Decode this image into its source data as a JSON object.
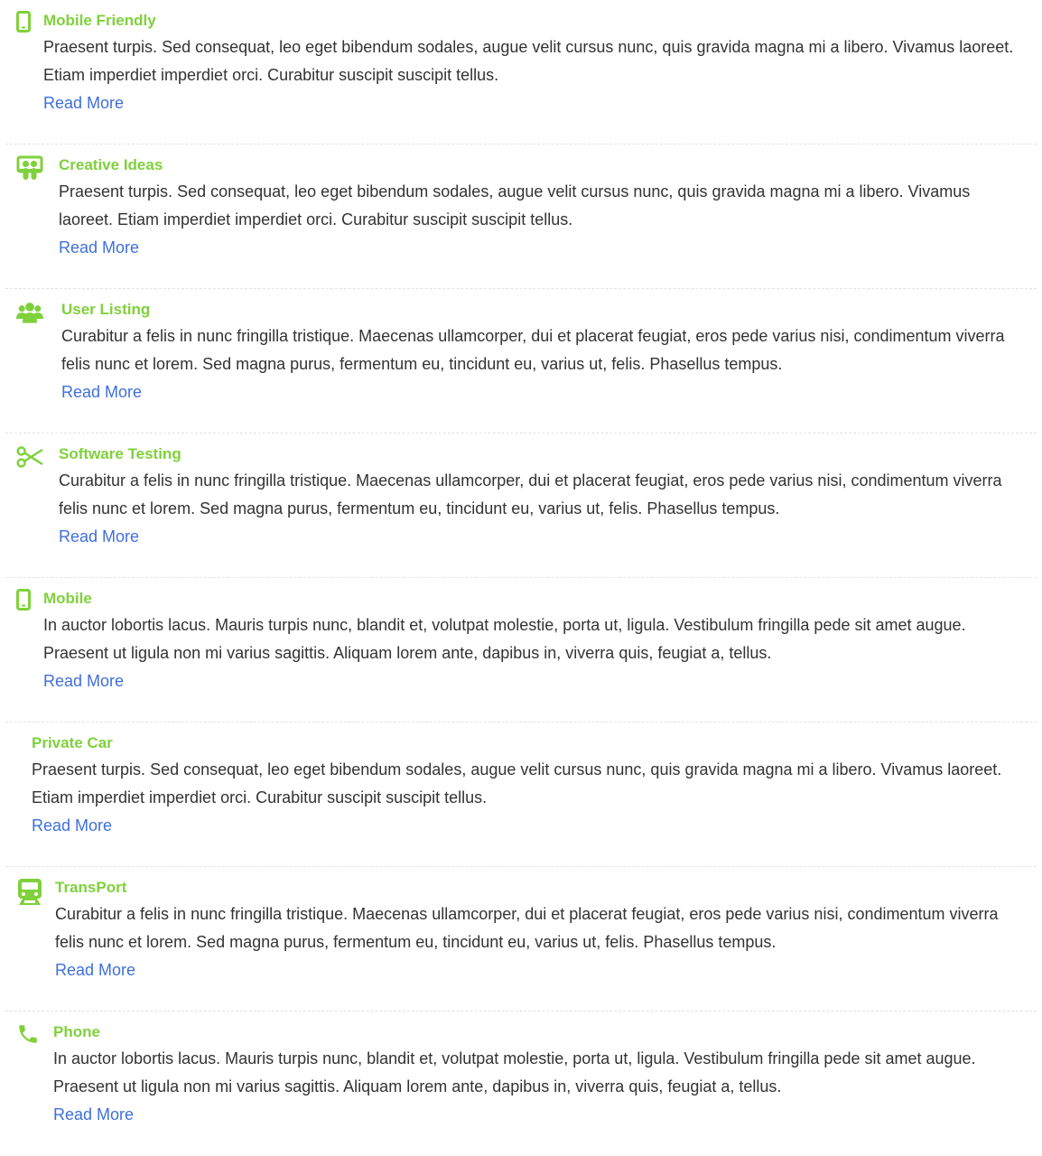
{
  "colors": {
    "accent": "#7fd13b",
    "text": "#333333",
    "link": "#3f6fdc",
    "divider": "#e3e3e3"
  },
  "items": [
    {
      "icon": "mobile-icon",
      "title": "Mobile Friendly",
      "description": "Praesent turpis. Sed consequat, leo eget bibendum sodales, augue velit cursus nunc, quis gravida magna mi a libero. Vivamus laoreet. Etiam imperdiet imperdiet orci. Curabitur suscipit suscipit tellus.",
      "link": "Read More"
    },
    {
      "icon": "slideshare-icon",
      "title": "Creative Ideas",
      "description": "Praesent turpis. Sed consequat, leo eget bibendum sodales, augue velit cursus nunc, quis gravida magna mi a libero. Vivamus laoreet. Etiam imperdiet imperdiet orci. Curabitur suscipit suscipit tellus.",
      "link": "Read More"
    },
    {
      "icon": "users-icon",
      "title": "User Listing",
      "description": "Curabitur a felis in nunc fringilla tristique. Maecenas ullamcorper, dui et placerat feugiat, eros pede varius nisi, condimentum viverra felis nunc et lorem. Sed magna purus, fermentum eu, tincidunt eu, varius ut, felis. Phasellus tempus.",
      "link": "Read More"
    },
    {
      "icon": "scissors-icon",
      "title": "Software Testing",
      "description": "Curabitur a felis in nunc fringilla tristique. Maecenas ullamcorper, dui et placerat feugiat, eros pede varius nisi, condimentum viverra felis nunc et lorem. Sed magna purus, fermentum eu, tincidunt eu, varius ut, felis. Phasellus tempus.",
      "link": "Read More"
    },
    {
      "icon": "mobile-icon",
      "title": "Mobile",
      "description": "In auctor lobortis lacus. Mauris turpis nunc, blandit et, volutpat molestie, porta ut, ligula. Vestibulum fringilla pede sit amet augue. Praesent ut ligula non mi varius sagittis. Aliquam lorem ante, dapibus in, viverra quis, feugiat a, tellus.",
      "link": "Read More"
    },
    {
      "icon": "",
      "title": "Private Car",
      "description": "Praesent turpis. Sed consequat, leo eget bibendum sodales, augue velit cursus nunc, quis gravida magna mi a libero. Vivamus laoreet. Etiam imperdiet imperdiet orci. Curabitur suscipit suscipit tellus.",
      "link": "Read More"
    },
    {
      "icon": "train-icon",
      "title": "TransPort",
      "description": "Curabitur a felis in nunc fringilla tristique. Maecenas ullamcorper, dui et placerat feugiat, eros pede varius nisi, condimentum viverra felis nunc et lorem. Sed magna purus, fermentum eu, tincidunt eu, varius ut, felis. Phasellus tempus.",
      "link": "Read More"
    },
    {
      "icon": "phone-icon",
      "title": "Phone",
      "description": "In auctor lobortis lacus. Mauris turpis nunc, blandit et, volutpat molestie, porta ut, ligula. Vestibulum fringilla pede sit amet augue. Praesent ut ligula non mi varius sagittis. Aliquam lorem ante, dapibus in, viverra quis, feugiat a, tellus.",
      "link": "Read More"
    }
  ]
}
